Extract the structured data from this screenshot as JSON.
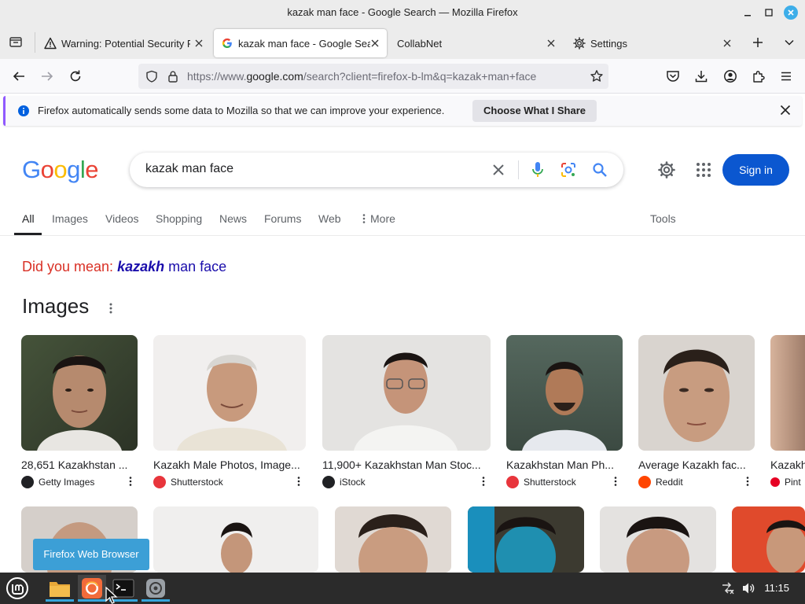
{
  "window": {
    "title": "kazak man face - Google Search — Mozilla Firefox"
  },
  "tabs": [
    {
      "label": "Warning: Potential Security Risk Ahead",
      "icon": "warning-icon"
    },
    {
      "label": "kazak man face - Google Search",
      "icon": "google-icon",
      "active": true
    },
    {
      "label": "CollabNet",
      "icon": ""
    },
    {
      "label": "Settings",
      "icon": "gear-icon"
    }
  ],
  "url": {
    "prefix": "https://www.",
    "host": "google.com",
    "path": "/search?client=firefox-b-lm&q=kazak+man+face"
  },
  "notification": {
    "message": "Firefox automatically sends some data to Mozilla so that we can improve your experience.",
    "button": "Choose What I Share"
  },
  "google": {
    "logo": "Google",
    "query": "kazak man face",
    "signin": "Sign in",
    "tabs": [
      "All",
      "Images",
      "Videos",
      "Shopping",
      "News",
      "Forums",
      "Web",
      "More"
    ],
    "tools": "Tools",
    "did_you_mean_label": "Did you mean:",
    "correction_bold": "kazakh",
    "correction_rest": "man face",
    "images_heading": "Images"
  },
  "images": [
    {
      "caption": "28,651 Kazakhstan ...",
      "source": "Getty Images",
      "fav_color": "#202124"
    },
    {
      "caption": "Kazakh Male Photos, Image...",
      "source": "Shutterstock",
      "fav_color": "#e8353c"
    },
    {
      "caption": "11,900+ Kazakhstan Man Stoc...",
      "source": "iStock",
      "fav_color": "#202124"
    },
    {
      "caption": "Kazakhstan Man Ph...",
      "source": "Shutterstock",
      "fav_color": "#e8353c"
    },
    {
      "caption": "Average Kazakh fac...",
      "source": "Reddit",
      "fav_color": "#ff4500"
    },
    {
      "caption": "Kazakh",
      "source": "Pint",
      "fav_color": "#e60023"
    }
  ],
  "tooltip": "Firefox Web Browser",
  "taskbar": {
    "clock": "11:15"
  },
  "colors": {
    "google_blue": "#0b57d0",
    "link_blue": "#1a0dab",
    "suggest_red": "#d93025",
    "taskbar": "#2b2b2b"
  }
}
